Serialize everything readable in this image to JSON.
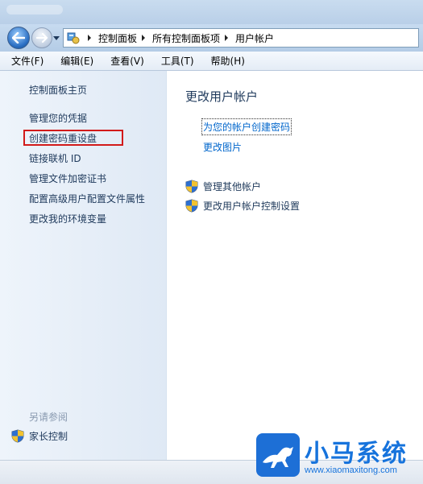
{
  "navigation": {
    "breadcrumbs": [
      "控制面板",
      "所有控制面板项",
      "用户帐户"
    ]
  },
  "menu": {
    "items": [
      "文件(F)",
      "编辑(E)",
      "查看(V)",
      "工具(T)",
      "帮助(H)"
    ]
  },
  "sidebar": {
    "home": "控制面板主页",
    "links": [
      "管理您的凭据",
      "创建密码重设盘",
      "链接联机 ID",
      "管理文件加密证书",
      "配置高级用户配置文件属性",
      "更改我的环境变量"
    ],
    "highlighted_link": "创建密码重设盘",
    "see_also_title": "另请参阅",
    "parental_controls": "家长控制"
  },
  "main": {
    "title": "更改用户帐户",
    "links": [
      "为您的帐户创建密码",
      "更改图片"
    ],
    "admin_links": [
      "管理其他帐户",
      "更改用户帐户控制设置"
    ]
  },
  "watermark": {
    "brand": "小马系统",
    "url": "www.xiaomaxitong.com"
  },
  "colors": {
    "link": "#0066cc",
    "highlight_border": "#d21a1a",
    "watermark": "#1673dc"
  },
  "icons": {
    "back": "back-arrow-icon",
    "forward": "forward-arrow-icon",
    "control_panel": "control-panel-icon",
    "uac_shield": "uac-shield-icon",
    "watermark_logo": "horse-logo"
  }
}
